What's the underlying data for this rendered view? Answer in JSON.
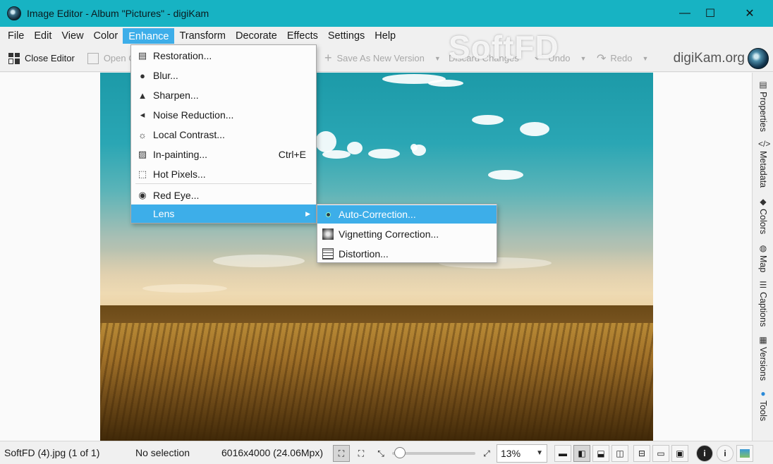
{
  "window": {
    "title": "Image Editor - Album \"Pictures\" - digiKam",
    "minimize": "—",
    "maximize": "☐",
    "close": "✕"
  },
  "menubar": {
    "items": [
      "File",
      "Edit",
      "View",
      "Color",
      "Enhance",
      "Transform",
      "Decorate",
      "Effects",
      "Settings",
      "Help"
    ],
    "active": "Enhance"
  },
  "toolbar": {
    "close_editor": "Close Editor",
    "open": "Open C",
    "save_as_new_version": "Save As New Version",
    "discard_changes": "Discard Changes",
    "undo": "Undo",
    "redo": "Redo",
    "brand": "digiKam.org"
  },
  "watermark": "SoftFD",
  "enhance_menu": {
    "items": [
      {
        "label": "Restoration...",
        "icon": "restoration-icon",
        "shortcut": ""
      },
      {
        "label": "Blur...",
        "icon": "blur-drop-icon",
        "shortcut": ""
      },
      {
        "label": "Sharpen...",
        "icon": "sharpen-triangle-icon",
        "shortcut": ""
      },
      {
        "label": "Noise Reduction...",
        "icon": "speaker-noise-icon",
        "shortcut": ""
      },
      {
        "label": "Local Contrast...",
        "icon": "sun-contrast-icon",
        "shortcut": ""
      },
      {
        "label": "In-painting...",
        "icon": "inpainting-icon",
        "shortcut": "Ctrl+E"
      },
      {
        "label": "Hot Pixels...",
        "icon": "hot-pixels-icon",
        "shortcut": ""
      },
      {
        "label": "Red Eye...",
        "icon": "eye-icon",
        "shortcut": ""
      },
      {
        "label": "Lens",
        "icon": "",
        "shortcut": ""
      }
    ]
  },
  "lens_submenu": {
    "items": [
      {
        "label": "Auto-Correction...",
        "icon": "lens-autocorrection-icon"
      },
      {
        "label": "Vignetting Correction...",
        "icon": "vignetting-icon"
      },
      {
        "label": "Distortion...",
        "icon": "distortion-icon"
      }
    ]
  },
  "sidebar": {
    "tabs": [
      {
        "label": "Properties",
        "icon": "properties-icon"
      },
      {
        "label": "Metadata",
        "icon": "metadata-code-icon"
      },
      {
        "label": "Colors",
        "icon": "colors-droplet-icon"
      },
      {
        "label": "Map",
        "icon": "globe-icon"
      },
      {
        "label": "Captions",
        "icon": "captions-icon"
      },
      {
        "label": "Versions",
        "icon": "versions-icon"
      },
      {
        "label": "Tools",
        "icon": "tools-sphere-icon"
      }
    ]
  },
  "statusbar": {
    "filename": "SoftFD (4).jpg (1 of 1)",
    "selection": "No selection",
    "dimensions": "6016x4000 (24.06Mpx)",
    "zoom": "13%"
  },
  "colors": {
    "titlebar": "#17b3c3",
    "accent": "#3daee9"
  }
}
